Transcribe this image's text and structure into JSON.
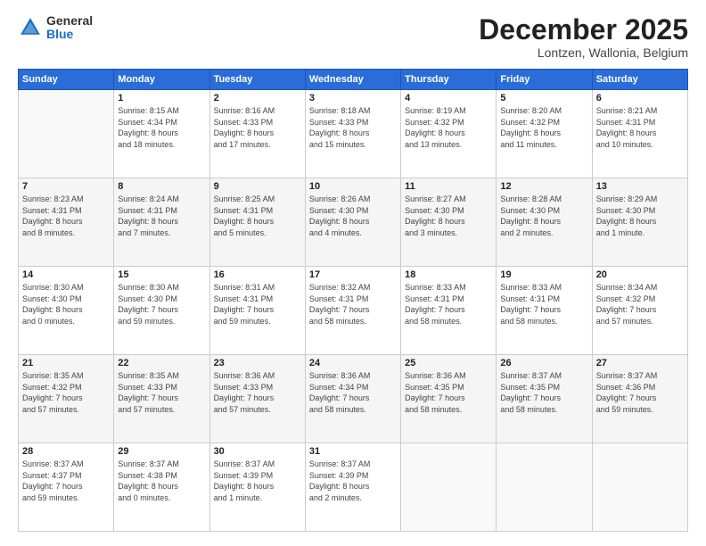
{
  "logo": {
    "general": "General",
    "blue": "Blue"
  },
  "header": {
    "month": "December 2025",
    "location": "Lontzen, Wallonia, Belgium"
  },
  "weekdays": [
    "Sunday",
    "Monday",
    "Tuesday",
    "Wednesday",
    "Thursday",
    "Friday",
    "Saturday"
  ],
  "weeks": [
    [
      {
        "day": "",
        "info": ""
      },
      {
        "day": "1",
        "info": "Sunrise: 8:15 AM\nSunset: 4:34 PM\nDaylight: 8 hours\nand 18 minutes."
      },
      {
        "day": "2",
        "info": "Sunrise: 8:16 AM\nSunset: 4:33 PM\nDaylight: 8 hours\nand 17 minutes."
      },
      {
        "day": "3",
        "info": "Sunrise: 8:18 AM\nSunset: 4:33 PM\nDaylight: 8 hours\nand 15 minutes."
      },
      {
        "day": "4",
        "info": "Sunrise: 8:19 AM\nSunset: 4:32 PM\nDaylight: 8 hours\nand 13 minutes."
      },
      {
        "day": "5",
        "info": "Sunrise: 8:20 AM\nSunset: 4:32 PM\nDaylight: 8 hours\nand 11 minutes."
      },
      {
        "day": "6",
        "info": "Sunrise: 8:21 AM\nSunset: 4:31 PM\nDaylight: 8 hours\nand 10 minutes."
      }
    ],
    [
      {
        "day": "7",
        "info": "Sunrise: 8:23 AM\nSunset: 4:31 PM\nDaylight: 8 hours\nand 8 minutes."
      },
      {
        "day": "8",
        "info": "Sunrise: 8:24 AM\nSunset: 4:31 PM\nDaylight: 8 hours\nand 7 minutes."
      },
      {
        "day": "9",
        "info": "Sunrise: 8:25 AM\nSunset: 4:31 PM\nDaylight: 8 hours\nand 5 minutes."
      },
      {
        "day": "10",
        "info": "Sunrise: 8:26 AM\nSunset: 4:30 PM\nDaylight: 8 hours\nand 4 minutes."
      },
      {
        "day": "11",
        "info": "Sunrise: 8:27 AM\nSunset: 4:30 PM\nDaylight: 8 hours\nand 3 minutes."
      },
      {
        "day": "12",
        "info": "Sunrise: 8:28 AM\nSunset: 4:30 PM\nDaylight: 8 hours\nand 2 minutes."
      },
      {
        "day": "13",
        "info": "Sunrise: 8:29 AM\nSunset: 4:30 PM\nDaylight: 8 hours\nand 1 minute."
      }
    ],
    [
      {
        "day": "14",
        "info": "Sunrise: 8:30 AM\nSunset: 4:30 PM\nDaylight: 8 hours\nand 0 minutes."
      },
      {
        "day": "15",
        "info": "Sunrise: 8:30 AM\nSunset: 4:30 PM\nDaylight: 7 hours\nand 59 minutes."
      },
      {
        "day": "16",
        "info": "Sunrise: 8:31 AM\nSunset: 4:31 PM\nDaylight: 7 hours\nand 59 minutes."
      },
      {
        "day": "17",
        "info": "Sunrise: 8:32 AM\nSunset: 4:31 PM\nDaylight: 7 hours\nand 58 minutes."
      },
      {
        "day": "18",
        "info": "Sunrise: 8:33 AM\nSunset: 4:31 PM\nDaylight: 7 hours\nand 58 minutes."
      },
      {
        "day": "19",
        "info": "Sunrise: 8:33 AM\nSunset: 4:31 PM\nDaylight: 7 hours\nand 58 minutes."
      },
      {
        "day": "20",
        "info": "Sunrise: 8:34 AM\nSunset: 4:32 PM\nDaylight: 7 hours\nand 57 minutes."
      }
    ],
    [
      {
        "day": "21",
        "info": "Sunrise: 8:35 AM\nSunset: 4:32 PM\nDaylight: 7 hours\nand 57 minutes."
      },
      {
        "day": "22",
        "info": "Sunrise: 8:35 AM\nSunset: 4:33 PM\nDaylight: 7 hours\nand 57 minutes."
      },
      {
        "day": "23",
        "info": "Sunrise: 8:36 AM\nSunset: 4:33 PM\nDaylight: 7 hours\nand 57 minutes."
      },
      {
        "day": "24",
        "info": "Sunrise: 8:36 AM\nSunset: 4:34 PM\nDaylight: 7 hours\nand 58 minutes."
      },
      {
        "day": "25",
        "info": "Sunrise: 8:36 AM\nSunset: 4:35 PM\nDaylight: 7 hours\nand 58 minutes."
      },
      {
        "day": "26",
        "info": "Sunrise: 8:37 AM\nSunset: 4:35 PM\nDaylight: 7 hours\nand 58 minutes."
      },
      {
        "day": "27",
        "info": "Sunrise: 8:37 AM\nSunset: 4:36 PM\nDaylight: 7 hours\nand 59 minutes."
      }
    ],
    [
      {
        "day": "28",
        "info": "Sunrise: 8:37 AM\nSunset: 4:37 PM\nDaylight: 7 hours\nand 59 minutes."
      },
      {
        "day": "29",
        "info": "Sunrise: 8:37 AM\nSunset: 4:38 PM\nDaylight: 8 hours\nand 0 minutes."
      },
      {
        "day": "30",
        "info": "Sunrise: 8:37 AM\nSunset: 4:39 PM\nDaylight: 8 hours\nand 1 minute."
      },
      {
        "day": "31",
        "info": "Sunrise: 8:37 AM\nSunset: 4:39 PM\nDaylight: 8 hours\nand 2 minutes."
      },
      {
        "day": "",
        "info": ""
      },
      {
        "day": "",
        "info": ""
      },
      {
        "day": "",
        "info": ""
      }
    ]
  ]
}
